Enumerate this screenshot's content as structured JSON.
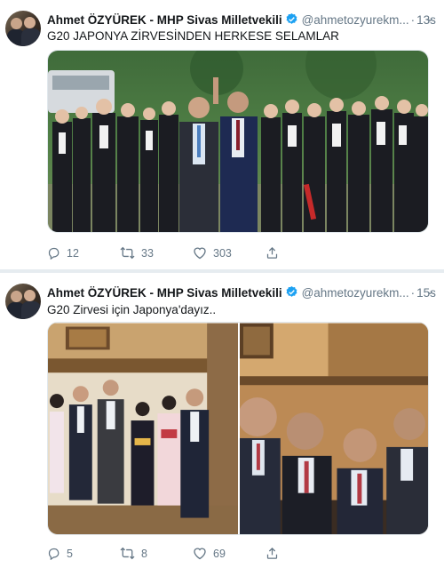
{
  "tweets": [
    {
      "author": {
        "name": "Ahmet ÖZYÜREK - MHP Sivas Milletvekili",
        "handle": "@ahmetozyurekm...",
        "verified": true
      },
      "time": "13s",
      "text": "G20 JAPONYA ZİRVESİNDEN HERKESE SELAMLAR",
      "stats": {
        "replies": "12",
        "retweets": "33",
        "likes": "303"
      }
    },
    {
      "author": {
        "name": "Ahmet ÖZYÜREK - MHP Sivas Milletvekili",
        "handle": "@ahmetozyurekm...",
        "verified": true
      },
      "time": "15s",
      "text": "G20 Zirvesi için Japonya'dayız..",
      "stats": {
        "replies": "5",
        "retweets": "8",
        "likes": "69"
      }
    }
  ],
  "icons": {
    "reply": "reply-icon",
    "retweet": "retweet-icon",
    "like": "heart-icon",
    "share": "share-icon",
    "verified": "verified-badge-icon",
    "more": "chevron-down-icon"
  },
  "colors": {
    "verified": "#1da1f2",
    "meta": "#657786",
    "divider": "#e6ecf0"
  }
}
